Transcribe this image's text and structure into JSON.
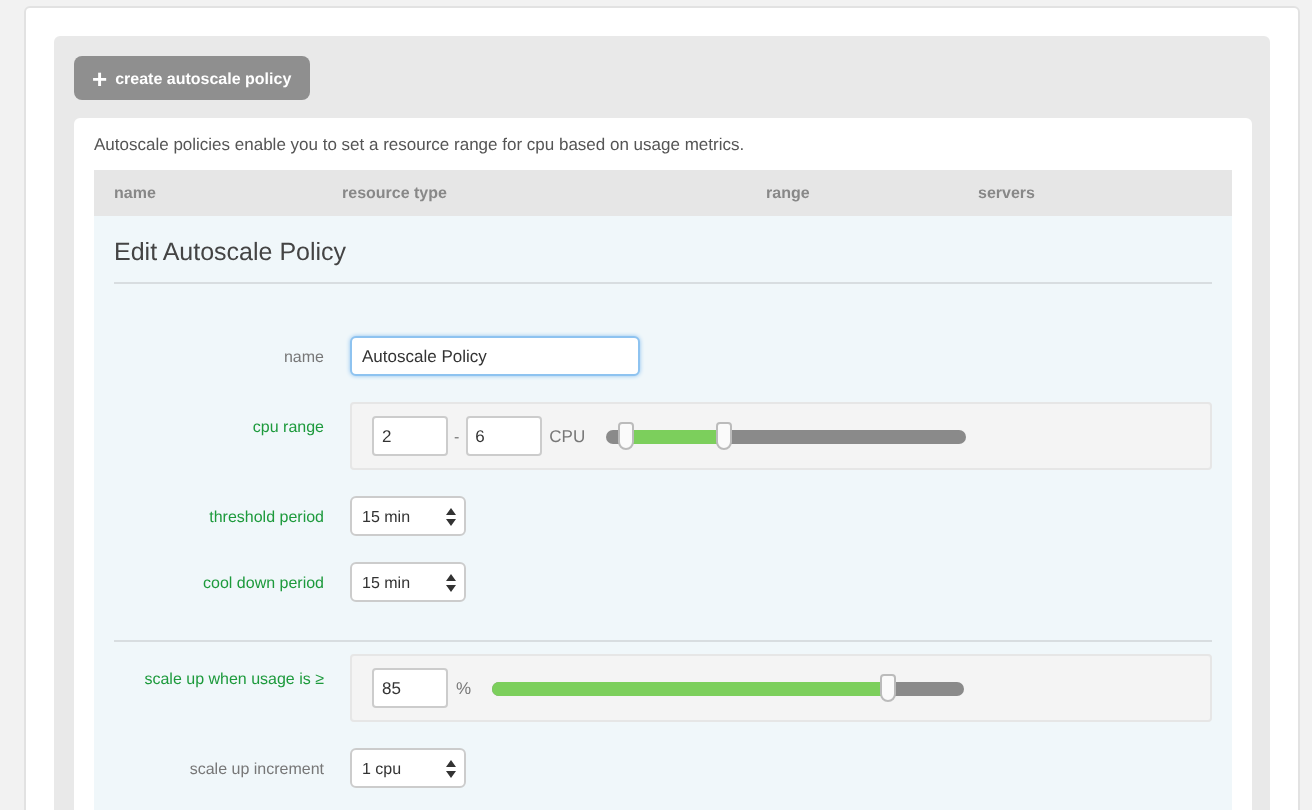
{
  "create_button": {
    "icon": "+",
    "label": "create autoscale policy"
  },
  "description": "Autoscale policies enable you to set a resource range for cpu based on usage metrics.",
  "table": {
    "columns": [
      "name",
      "resource type",
      "range",
      "servers"
    ]
  },
  "editor": {
    "title": "Edit Autoscale Policy",
    "groups": [
      [
        {
          "kind": "text",
          "label": "name",
          "changed": false,
          "value": "Autoscale Policy",
          "focused": true
        },
        {
          "kind": "range",
          "label": "cpu range",
          "changed": true,
          "min": "2",
          "separator": "-",
          "max": "6",
          "unit": "CPU",
          "thumbs": [
            {
              "level": 0.06
            },
            {
              "level": 0.33
            }
          ]
        },
        {
          "kind": "select",
          "label": "threshold period",
          "changed": true,
          "value": "15 min"
        },
        {
          "kind": "select",
          "label": "cool down period",
          "changed": true,
          "value": "15 min"
        }
      ],
      [
        {
          "kind": "slider",
          "label": "scale up when usage is ≥",
          "changed": true,
          "value": "85",
          "unit": "%",
          "level": 0.84
        },
        {
          "kind": "select",
          "label": "scale up increment",
          "changed": false,
          "value": "1 cpu"
        }
      ]
    ]
  }
}
